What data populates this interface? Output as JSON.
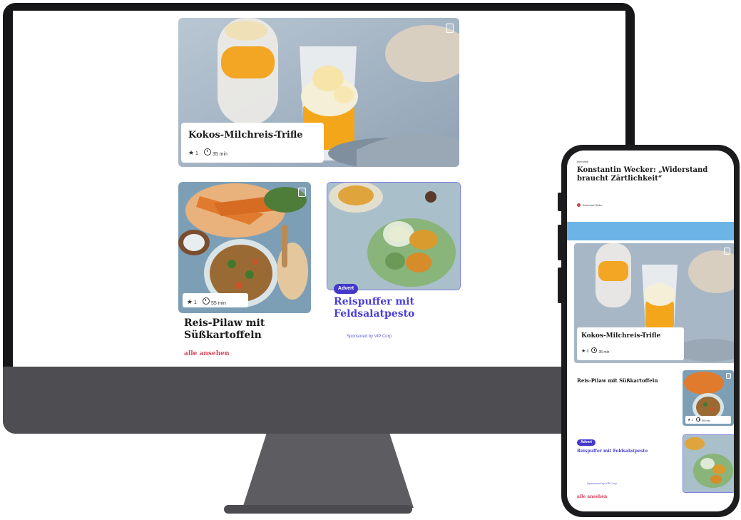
{
  "desktop": {
    "featured": {
      "title": "Kokos-Milchreis-Trifle",
      "rating": "1",
      "time": "35 min"
    },
    "card_left": {
      "title": "Reis-Pilaw mit Süßkartoffeln",
      "rating": "1",
      "time": "55 min"
    },
    "card_right": {
      "badge": "Advert",
      "title": "Reispuffer mit Feldsalatpesto",
      "sponsor": "Sponsored by VIP Corp"
    },
    "more_link": "alle ansehen"
  },
  "phone": {
    "interview": {
      "kicker": "Interview",
      "title": "Konstantin Wecker: „Widerstand braucht Zärtlichkeit“",
      "author": "Bernhard Seiler"
    },
    "featured": {
      "title": "Kokos-Milchreis-Trifle",
      "rating": "0",
      "time": "35 min"
    },
    "list_item_1": {
      "title": "Reis-Pilaw mit Süßkartoffeln",
      "rating": "1",
      "time": "55 min"
    },
    "list_item_2": {
      "badge": "Advert",
      "title": "Reispuffer mit Feldsalatpesto",
      "sponsor": "Sponsored by VIP Corp"
    },
    "more_link": "alle ansehen"
  },
  "colors": {
    "accent": "#4338ca",
    "link_red": "#d6455b",
    "monitor_bezel": "#161618",
    "monitor_chin": "#4e4d52",
    "sky_blue": "#6cb4e6"
  },
  "icons": [
    "bookmark-icon",
    "star-icon",
    "clock-icon",
    "author-avatar-icon"
  ]
}
